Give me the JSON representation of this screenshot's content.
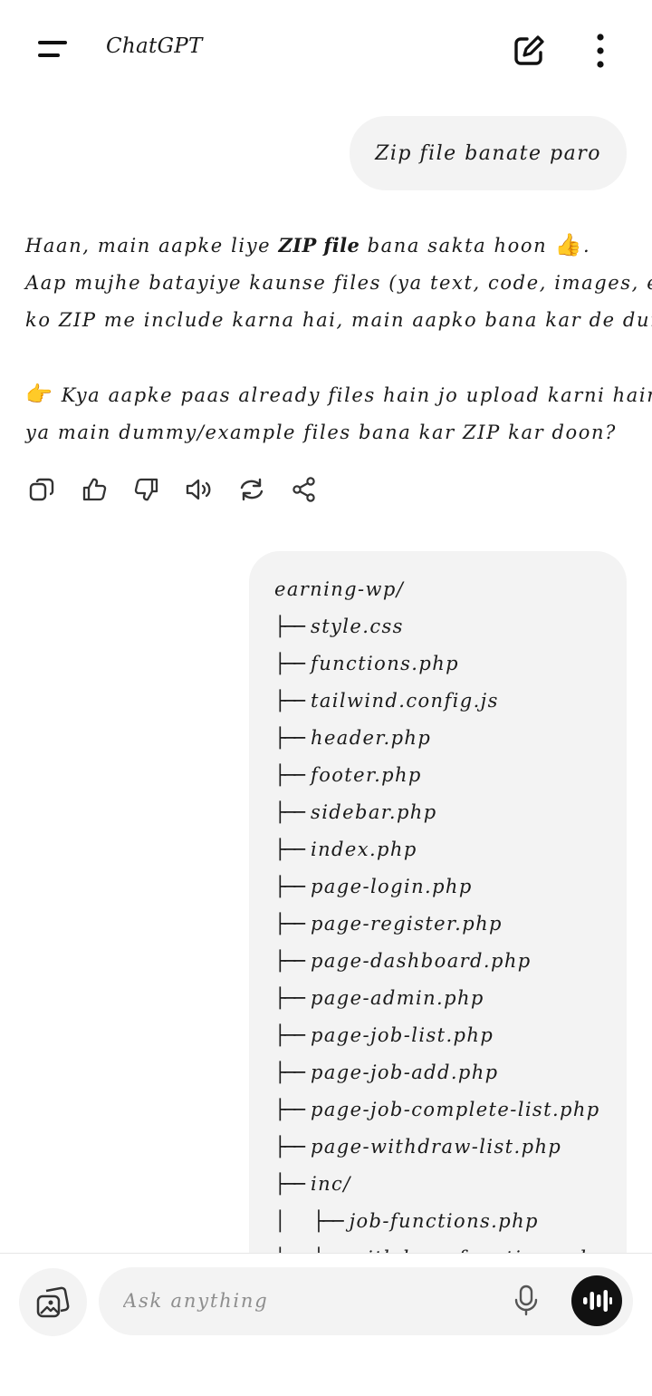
{
  "header": {
    "title": "ChatGPT",
    "menu_icon": "hamburger-menu-icon",
    "new_chat_icon": "new-chat-icon",
    "more_icon": "more-vertical-icon"
  },
  "messages": {
    "user_1": {
      "text": "Zip file banate paro"
    },
    "assistant_1": {
      "line1_pre": "Haan, main aapke liye ",
      "line1_bold": "ZIP file",
      "line1_post": " bana sakta hoon ",
      "line1_emoji": "👍",
      "line1_end": ".",
      "line2": "Aap mujhe batayiye kaunse files (ya text, code, images, etc.)",
      "line3": "ko ZIP me include karna hai, main aapko bana kar de dunga.",
      "line4_emoji": "👉",
      "line4": " Kya aapke paas already files hain jo upload karni hain,",
      "line5": "ya main dummy/example files bana kar ZIP kar doon?"
    },
    "actions": [
      "copy-icon",
      "thumbs-up-icon",
      "thumbs-down-icon",
      "read-aloud-icon",
      "regenerate-icon",
      "share-icon"
    ],
    "user_2": {
      "tree_root": "earning-wp/",
      "branch": "├──",
      "nested_prefix": "│   ",
      "items": [
        "style.css",
        "functions.php",
        "tailwind.config.js",
        "header.php",
        "footer.php",
        "sidebar.php",
        "index.php",
        "page-login.php",
        "page-register.php",
        "page-dashboard.php",
        "page-admin.php",
        "page-job-list.php",
        "page-job-add.php",
        "page-job-complete-list.php",
        "page-withdraw-list.php",
        "inc/"
      ],
      "nested_items": [
        "job-functions.php",
        "withdraw-functions.php"
      ]
    }
  },
  "composer": {
    "placeholder": "Ask anything",
    "attach_icon": "image-gallery-icon",
    "mic_icon": "microphone-icon",
    "voice_icon": "voice-mode-icon"
  }
}
